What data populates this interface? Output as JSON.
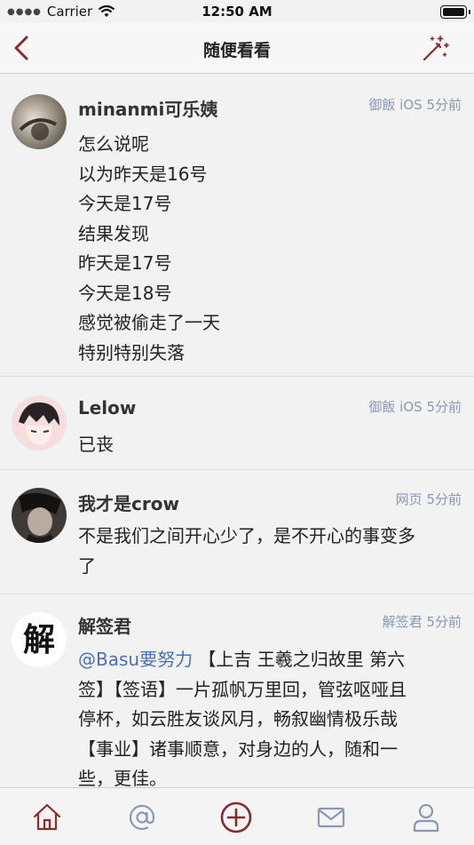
{
  "status_bar": {
    "carrier": "Carrier",
    "time": "12:50 AM"
  },
  "nav": {
    "title": "随便看看",
    "back_icon": "chevron-left-icon",
    "right_icon": "magic-wand-icon"
  },
  "accent_color": "#8b2a2a",
  "meta_color": "#8a97b5",
  "posts": [
    {
      "author": "minanmi可乐姨",
      "source": "御飯 iOS",
      "time": "5分前",
      "content": "怎么说呢\n以为昨天是16号\n今天是17号\n结果发现\n昨天是17号\n今天是18号\n感觉被偷走了一天\n特别特别失落"
    },
    {
      "author": "Lelow",
      "source": "御飯 iOS",
      "time": "5分前",
      "content": "已丧"
    },
    {
      "author": "我才是crow",
      "source": "网页",
      "time": "5分前",
      "content": "不是我们之间开心少了，是不开心的事变多\n了"
    },
    {
      "author": "解签君",
      "source": "解签君",
      "time": "5分前",
      "avatar_char": "解",
      "mention": "@Basu要努力",
      "content": " 【上吉 王羲之归故里 第六\n签】【签语】一片孤帆万里回，管弦呕哑且\n停杯，如云胜友谈风月，畅叙幽情极乐哉\n【事业】诸事顺意，对身边的人，随和一\n些，更佳。"
    }
  ],
  "tabbar": {
    "items": [
      {
        "name": "home",
        "icon": "home-icon",
        "active": true
      },
      {
        "name": "mentions",
        "icon": "at-icon",
        "active": false
      },
      {
        "name": "compose",
        "icon": "plus-circle-icon",
        "active": false
      },
      {
        "name": "messages",
        "icon": "envelope-icon",
        "active": false
      },
      {
        "name": "profile",
        "icon": "person-icon",
        "active": false
      }
    ]
  }
}
